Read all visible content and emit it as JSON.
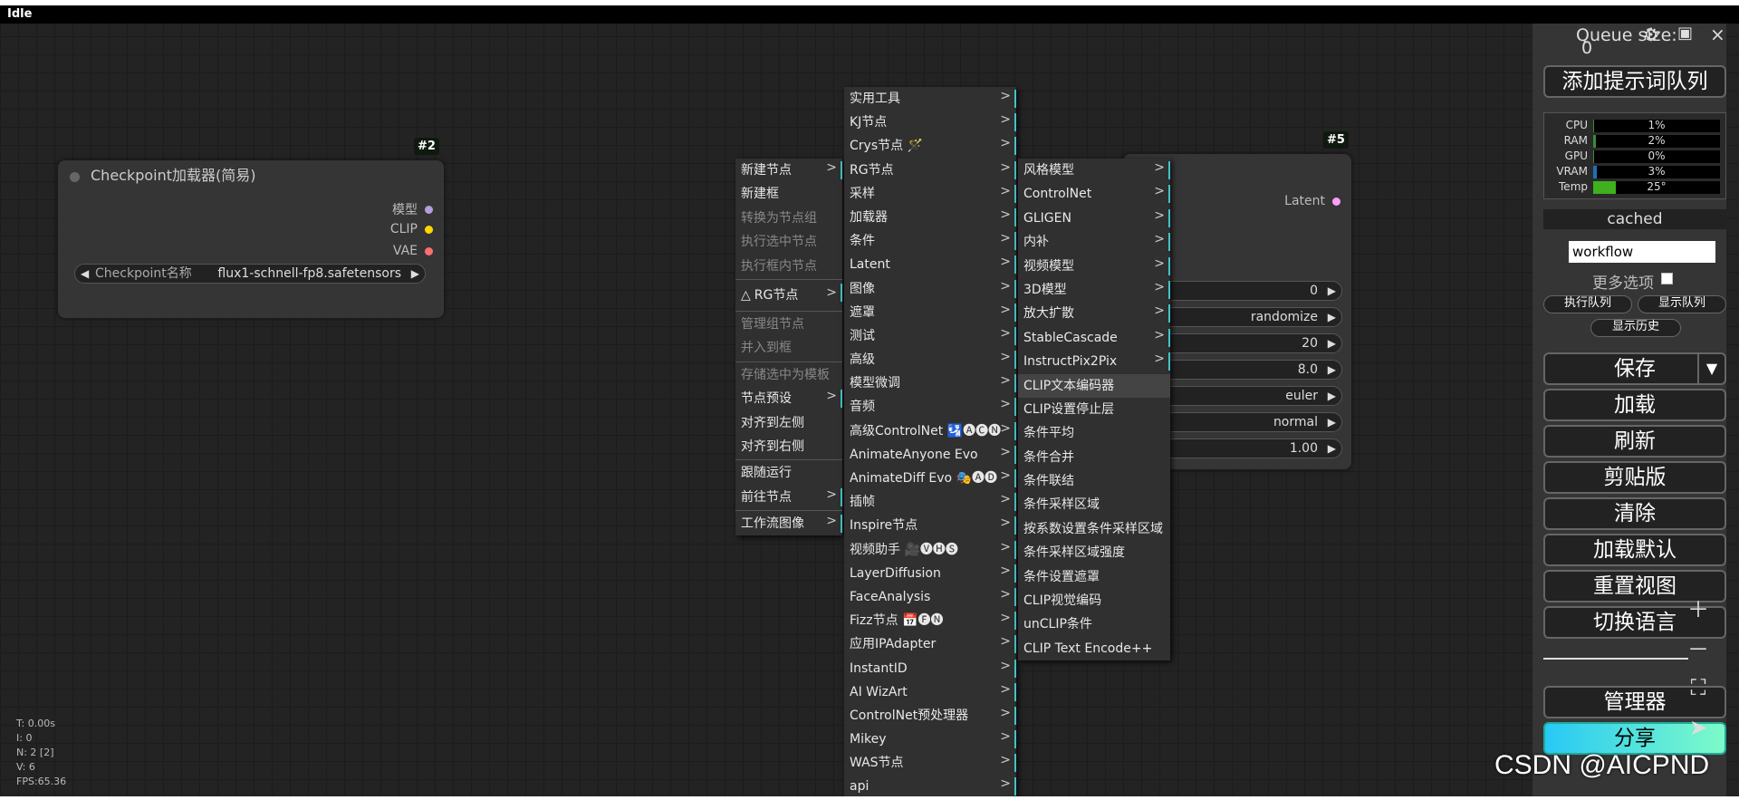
{
  "status": "Idle",
  "node2": {
    "id": "#2",
    "title": "Checkpoint加载器(简易)",
    "outputs": [
      "模型",
      "CLIP",
      "VAE"
    ],
    "output_colors": [
      "#b39ddb",
      "#ffd500",
      "#ff6e6e"
    ],
    "widget_label": "Checkpoint名称",
    "widget_value": "flux1-schnell-fp8.safetensors"
  },
  "node5": {
    "id": "#5",
    "output": "Latent",
    "output_color": "#ff9cf9",
    "widgets": [
      "0",
      "randomize",
      "20",
      "8.0",
      "euler",
      "normal",
      "1.00"
    ]
  },
  "menu1": {
    "items": [
      {
        "label": "新建节点",
        "sub": ">"
      },
      {
        "label": "新建框"
      },
      {
        "label": "转换为节点组",
        "disabled": true
      },
      {
        "label": "执行选中节点",
        "disabled": true
      },
      {
        "label": "执行框内节点",
        "disabled": true
      },
      {
        "label": "RG节点",
        "sub": ">",
        "icon": "△"
      },
      {
        "label": "管理组节点",
        "disabled": true
      },
      {
        "label": "并入到框",
        "disabled": true
      },
      {
        "label": "存储选中为模板",
        "disabled": true
      },
      {
        "label": "节点预设",
        "sub": ">"
      },
      {
        "label": "对齐到左侧"
      },
      {
        "label": "对齐到右侧"
      },
      {
        "label": "跟随运行"
      },
      {
        "label": "前往节点",
        "sub": ">"
      },
      {
        "label": "工作流图像",
        "sub": ">"
      }
    ]
  },
  "menu2": {
    "items": [
      "实用工具",
      "KJ节点",
      "Crys节点 🪄",
      "RG节点",
      "采样",
      "加载器",
      "条件",
      "Latent",
      "图像",
      "遮罩",
      "测试",
      "高级",
      "模型微调",
      "音频",
      "高级ControlNet 🛂🅐🅒🅝",
      "AnimateAnyone Evo",
      "AnimateDiff Evo 🎭🅐🅓",
      "插帧",
      "Inspire节点",
      "视频助手 🎥🅥🅗🅢",
      "LayerDiffusion",
      "FaceAnalysis",
      "Fizz节点 📅🅕🅝",
      "应用IPAdapter",
      "InstantID",
      "AI WizArt",
      "ControlNet预处理器",
      "Mikey",
      "WAS节点",
      "api"
    ],
    "sub": ">"
  },
  "menu3": {
    "items": [
      "风格模型",
      "ControlNet",
      "GLIGEN",
      "内补",
      "视频模型",
      "3D模型",
      "放大扩散",
      "StableCascade",
      "InstructPix2Pix",
      "CLIP文本编码器",
      "CLIP设置停止层",
      "条件平均",
      "条件合并",
      "条件联结",
      "条件采样区域",
      "按系数设置条件采样区域",
      "条件采样区域强度",
      "条件设置遮罩",
      "CLIP视觉编码",
      "unCLIP条件",
      "CLIP Text Encode++"
    ],
    "sub": ">",
    "highlight": "CLIP文本编码器"
  },
  "sidebar": {
    "queue_label": "Queue size:",
    "queue_value": "0",
    "add_queue": "添加提示词队列",
    "stats": [
      {
        "label": "CPU",
        "value": "1%",
        "pct": 1,
        "color": "#3a8a3a"
      },
      {
        "label": "RAM",
        "value": "2%",
        "pct": 2,
        "color": "#3a8a3a"
      },
      {
        "label": "GPU",
        "value": "0%",
        "pct": 0,
        "color": "#3a8a3a"
      },
      {
        "label": "VRAM",
        "value": "3%",
        "pct": 3,
        "color": "#1e6fb8"
      },
      {
        "label": "Temp",
        "value": "25°",
        "pct": 18,
        "color": "#3fb01e"
      }
    ],
    "cached": "cached",
    "workflow": "workflow",
    "more_options": "更多选项",
    "run_queue": "执行队列",
    "show_queue": "显示队列",
    "show_history": "显示历史",
    "save": "保存",
    "load": "加载",
    "refresh": "刷新",
    "clipspace": "剪贴版",
    "clear": "清除",
    "load_default": "加载默认",
    "reset_view": "重置视图",
    "switch_lang": "切换语言",
    "manager": "管理器",
    "share": "分享"
  },
  "debug": [
    "T: 0.00s",
    "I: 0",
    "N: 2 [2]",
    "V: 6",
    "FPS:65.36"
  ],
  "watermark": "CSDN @AICPND"
}
